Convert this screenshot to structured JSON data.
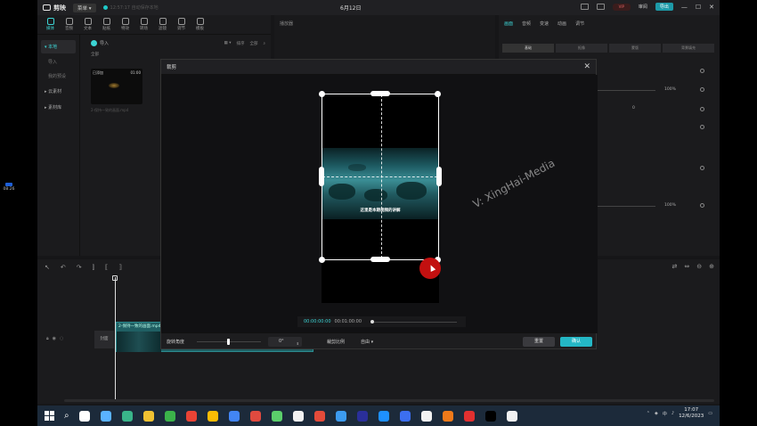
{
  "app": {
    "title": "6月12日",
    "logo": "剪映",
    "menu": "菜单",
    "autosave": "12:57:17 自动保存本地"
  },
  "titlebar_right": {
    "vip_badge": "VIP",
    "share_label": "审阅",
    "export_label": "导出",
    "window_controls": [
      "—",
      "☐",
      "✕"
    ]
  },
  "toolbar": [
    "媒体",
    "音频",
    "文本",
    "贴纸",
    "特效",
    "转场",
    "滤镜",
    "调节",
    "模板"
  ],
  "left_side": {
    "items": [
      "本地",
      "导入",
      "我的预设",
      "云素材",
      "素材库"
    ],
    "import": "导入",
    "all": "全部",
    "thumb_badge": "已添加",
    "thumb_duration": "01:00",
    "thumb_name": "2-保持一致的画面.mp4",
    "tools": [
      "排序",
      "全部",
      "筛选"
    ]
  },
  "player": {
    "title": "播放器"
  },
  "right_panel": {
    "tabs": [
      "画面",
      "音频",
      "变速",
      "动画",
      "调节"
    ],
    "sub_tabs": [
      "基础",
      "抠像",
      "蒙版",
      "背景填充"
    ],
    "pct1": "100%",
    "pct2": "100%",
    "num": "0"
  },
  "timeline": {
    "track_label": "封面",
    "clip_name": "2-保持一致的画面.mp4  00:01:00:00"
  },
  "left_edge": {
    "time": "08:26"
  },
  "dialog": {
    "title": "裁剪",
    "subtitle": "这里是本期视频的讲解",
    "watermark": "V: XingHai-Media",
    "timecode_current": "00:00:00:00",
    "timecode_total": "00:01:00:00",
    "rotate_label": "旋转角度",
    "rotate_value": "0°",
    "ratio_label": "裁剪比例",
    "ratio_value": "自由",
    "reset_label": "重置",
    "confirm_label": "确认"
  },
  "taskbar": {
    "time": "17:07",
    "date": "12/6/2023",
    "ime": "中",
    "app_colors": [
      "#ffffff",
      "#5ab2ff",
      "#39b58a",
      "#f1c232",
      "#3bb34a",
      "#ea4335",
      "#fbbc05",
      "#4285f4",
      "#e04a3f",
      "#5bcf6b",
      "#f2f2f2",
      "#e44b3a",
      "#3c9bf0",
      "#2a2f9a",
      "#1e90ff",
      "#3c6ff0",
      "#f2f2f2",
      "#f07a1a",
      "#e23030",
      "#000000",
      "#f2f2f2"
    ]
  },
  "colors": {
    "accent": "#3cd4d4",
    "confirm": "#24b7c5",
    "cursor_marker": "#c21010"
  }
}
